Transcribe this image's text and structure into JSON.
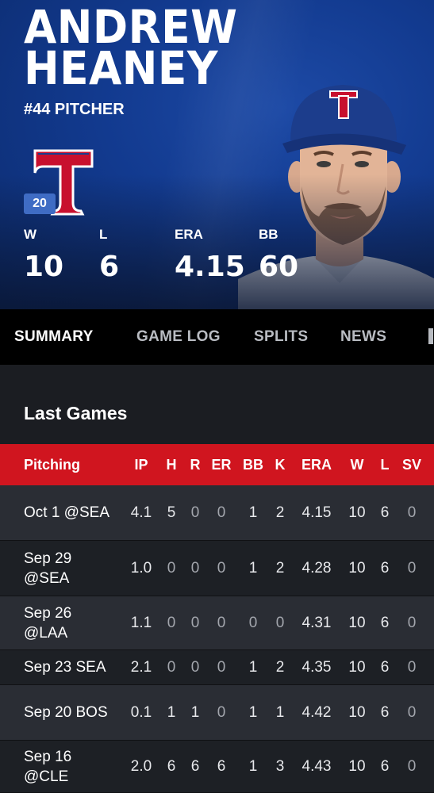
{
  "player": {
    "first_name": "ANDREW",
    "last_name": "HEANEY",
    "number_position": "#44 PITCHER",
    "season_badge": "20"
  },
  "season_stats": [
    {
      "label": "W",
      "value": "10"
    },
    {
      "label": "L",
      "value": "6"
    },
    {
      "label": "ERA",
      "value": "4.15"
    },
    {
      "label": "BB",
      "value": "60"
    }
  ],
  "tabs": [
    {
      "label": "SUMMARY",
      "active": true
    },
    {
      "label": "GAME LOG",
      "active": false
    },
    {
      "label": "SPLITS",
      "active": false
    },
    {
      "label": "NEWS",
      "active": false
    }
  ],
  "section": {
    "title": "Last Games"
  },
  "table": {
    "columns": [
      "Pitching",
      "IP",
      "H",
      "R",
      "ER",
      "BB",
      "K",
      "ERA",
      "W",
      "L",
      "SV"
    ],
    "rows": [
      {
        "game": "Oct 1 @SEA",
        "ip": "4.1",
        "h": "5",
        "r": "0",
        "er": "0",
        "bb": "1",
        "k": "2",
        "era": "4.15",
        "w": "10",
        "l": "6",
        "sv": "0"
      },
      {
        "game": "Sep 29 @SEA",
        "ip": "1.0",
        "h": "0",
        "r": "0",
        "er": "0",
        "bb": "1",
        "k": "2",
        "era": "4.28",
        "w": "10",
        "l": "6",
        "sv": "0"
      },
      {
        "game": "Sep 26 @LAA",
        "ip": "1.1",
        "h": "0",
        "r": "0",
        "er": "0",
        "bb": "0",
        "k": "0",
        "era": "4.31",
        "w": "10",
        "l": "6",
        "sv": "0"
      },
      {
        "game": "Sep 23 SEA",
        "ip": "2.1",
        "h": "0",
        "r": "0",
        "er": "0",
        "bb": "1",
        "k": "2",
        "era": "4.35",
        "w": "10",
        "l": "6",
        "sv": "0"
      },
      {
        "game": "Sep 20 BOS",
        "ip": "0.1",
        "h": "1",
        "r": "1",
        "er": "0",
        "bb": "1",
        "k": "1",
        "era": "4.42",
        "w": "10",
        "l": "6",
        "sv": "0"
      },
      {
        "game": "Sep 16 @CLE",
        "ip": "2.0",
        "h": "6",
        "r": "6",
        "er": "6",
        "bb": "1",
        "k": "3",
        "era": "4.43",
        "w": "10",
        "l": "6",
        "sv": "0"
      }
    ]
  },
  "colors": {
    "hero_blue": "#123a8f",
    "header_red": "#d0151f",
    "logo_red": "#c8102e",
    "tab_bar": "#000000"
  },
  "icons": {
    "team_logo": "rangers-t-logo-icon",
    "headshot": "player-headshot-icon"
  }
}
